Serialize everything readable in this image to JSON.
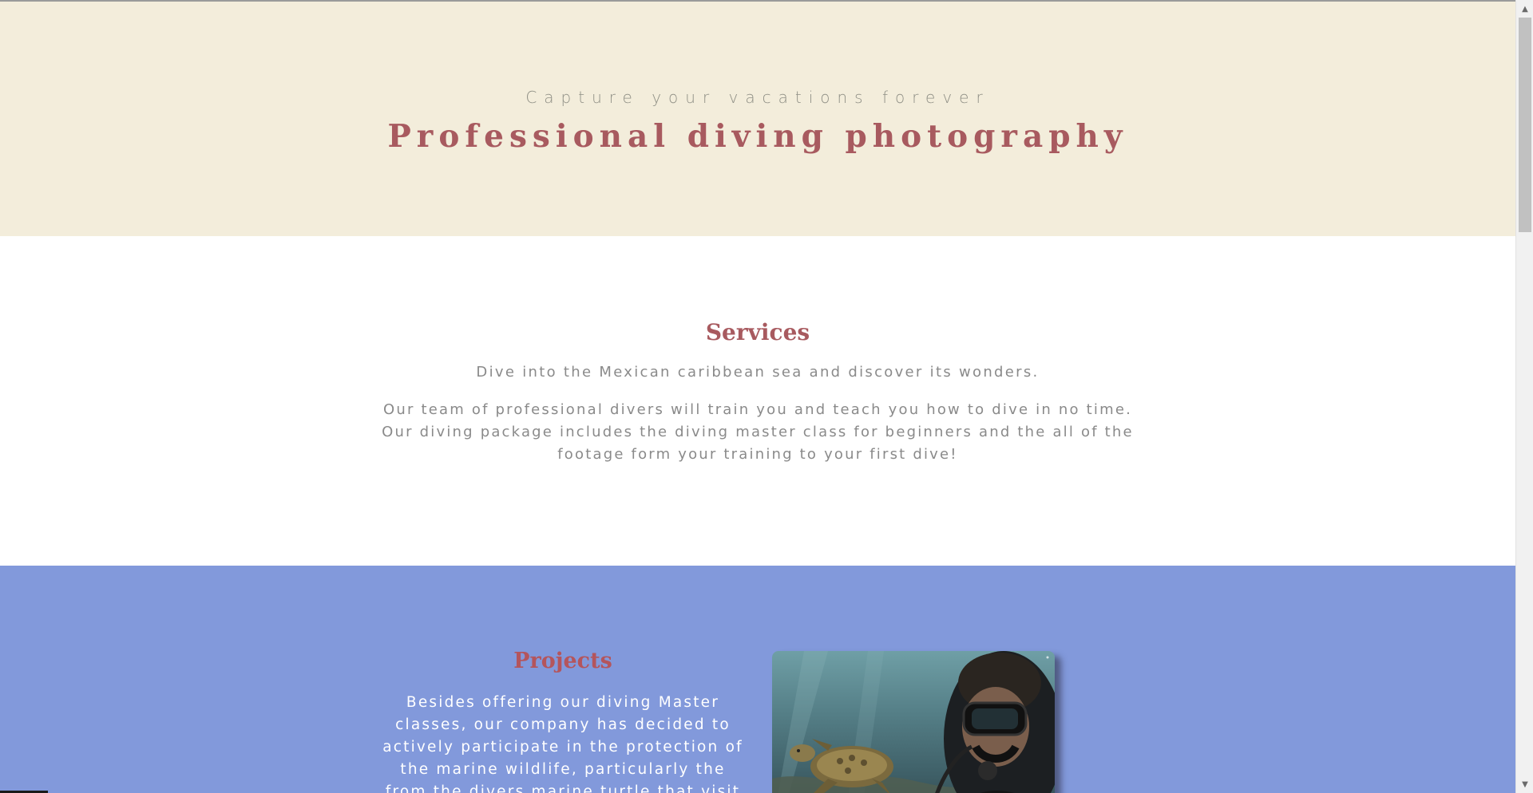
{
  "hero": {
    "kicker": "Capture your vacations forever",
    "title": "Professional diving photography",
    "background": "#f3eddb",
    "title_color": "#a85a5f"
  },
  "services": {
    "heading": "Services",
    "lead": "Dive into the Mexican caribbean sea and discover its wonders.",
    "body": "Our team of professional divers will train you and teach you how to dive in no time. Our diving package includes the diving master class for beginners and the all of the footage form your training to your first dive!",
    "heading_color": "#a85a5f"
  },
  "projects": {
    "heading": "Projects",
    "body": "Besides offering our diving Master classes, our company has decided to actively participate in the protection of the marine wildlife, particularly the from the divers marine turtle that visit Cancun's",
    "background": "#8299db",
    "heading_color": "#b4555c",
    "photo_icon": "diver-with-sea-turtle-photo"
  },
  "scrollbar": {
    "up_icon": "▲",
    "down_icon": "▼"
  }
}
